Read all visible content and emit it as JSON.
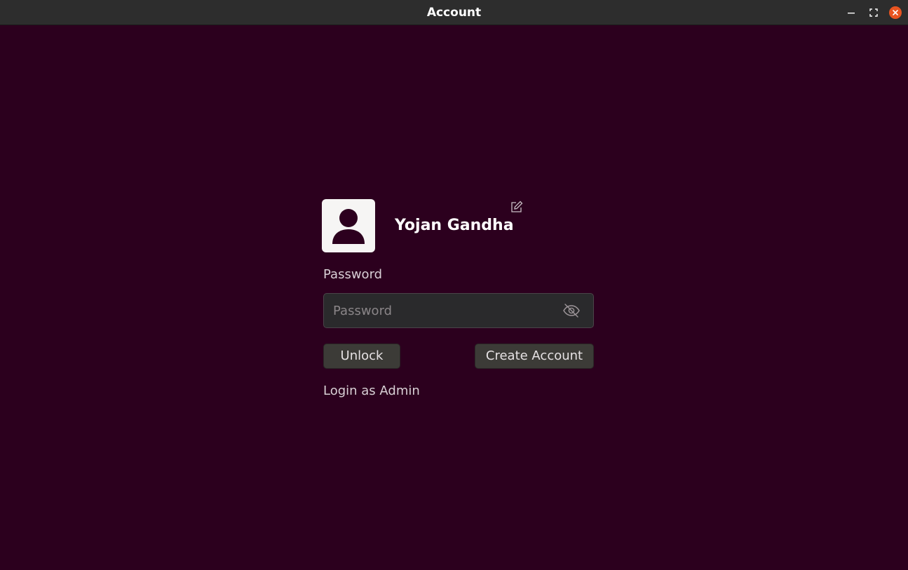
{
  "window": {
    "title": "Account",
    "controls": [
      "minimize-icon",
      "maximize-icon",
      "close-icon"
    ],
    "accent_color": "#e95420",
    "background_color": "#2c001e"
  },
  "profile": {
    "avatar_icon": "user-icon",
    "name": "Yojan Gandha",
    "edit_icon": "edit-icon"
  },
  "password": {
    "label": "Password",
    "placeholder": "Password",
    "value": "",
    "visibility_icon": "eye-slash-icon"
  },
  "actions": {
    "unlock_label": "Unlock",
    "create_account_label": "Create Account",
    "admin_login_label": "Login as Admin"
  }
}
